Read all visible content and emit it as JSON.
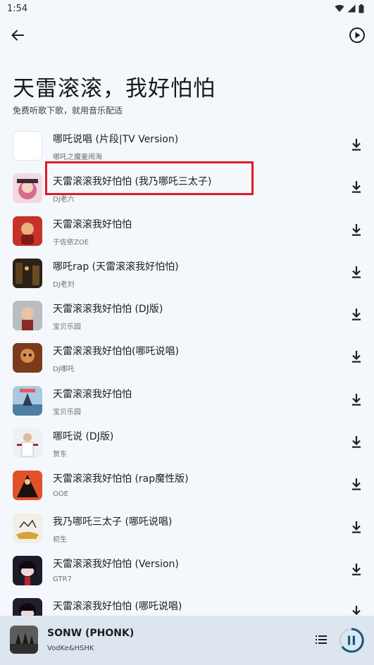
{
  "status_bar": {
    "time": "1:54"
  },
  "header": {
    "title": "天雷滚滚，我好怕怕",
    "subtitle": "免费听歌下歌，就用音乐配适"
  },
  "songs": [
    {
      "title": "哪吒说唱 (片段|TV Version)",
      "artist": "哪吒之魔童闹海",
      "cover": "blank"
    },
    {
      "title": "天雷滚滚我好怕怕 (我乃哪吒三太子)",
      "artist": "DJ老六",
      "cover": "anime-pink"
    },
    {
      "title": "天雷滚滚我好怕怕",
      "artist": "于佐依ZOE",
      "cover": "red-character"
    },
    {
      "title": "哪吒rap (天雷滚滚我好怕怕)",
      "artist": "DJ老刘",
      "cover": "dark-street"
    },
    {
      "title": "天雷滚滚我好怕怕 (DJ版)",
      "artist": "宝贝乐园",
      "cover": "child-gray"
    },
    {
      "title": "天雷滚滚我好怕怕(哪吒说唱)",
      "artist": "DJ哪吒",
      "cover": "orange-character"
    },
    {
      "title": "天雷滚滚我好怕怕",
      "artist": "宝贝乐园",
      "cover": "blue-scene"
    },
    {
      "title": "哪吒说 (DJ版)",
      "artist": "贺东",
      "cover": "person-white"
    },
    {
      "title": "天雷滚滚我好怕怕 (rap魔性版)",
      "artist": "OOE",
      "cover": "red-action"
    },
    {
      "title": "我乃哪吒三太子 (哪吒说唱)",
      "artist": "初生",
      "cover": "sketch-boat"
    },
    {
      "title": "天雷滚滚我好怕怕 (Version)",
      "artist": "GTR7",
      "cover": "dark-girl"
    },
    {
      "title": "天雷滚滚我好怕怕 (哪吒说唱)",
      "artist": "",
      "cover": "dark-girl-2"
    }
  ],
  "now_playing": {
    "title": "SONW (PHONK)",
    "artist": "VodKe&HSHK"
  },
  "colors": {
    "background": "#f4f8fc",
    "player_bar": "#dde6ee",
    "highlight": "#e01b24",
    "accent": "#0e5b83"
  }
}
